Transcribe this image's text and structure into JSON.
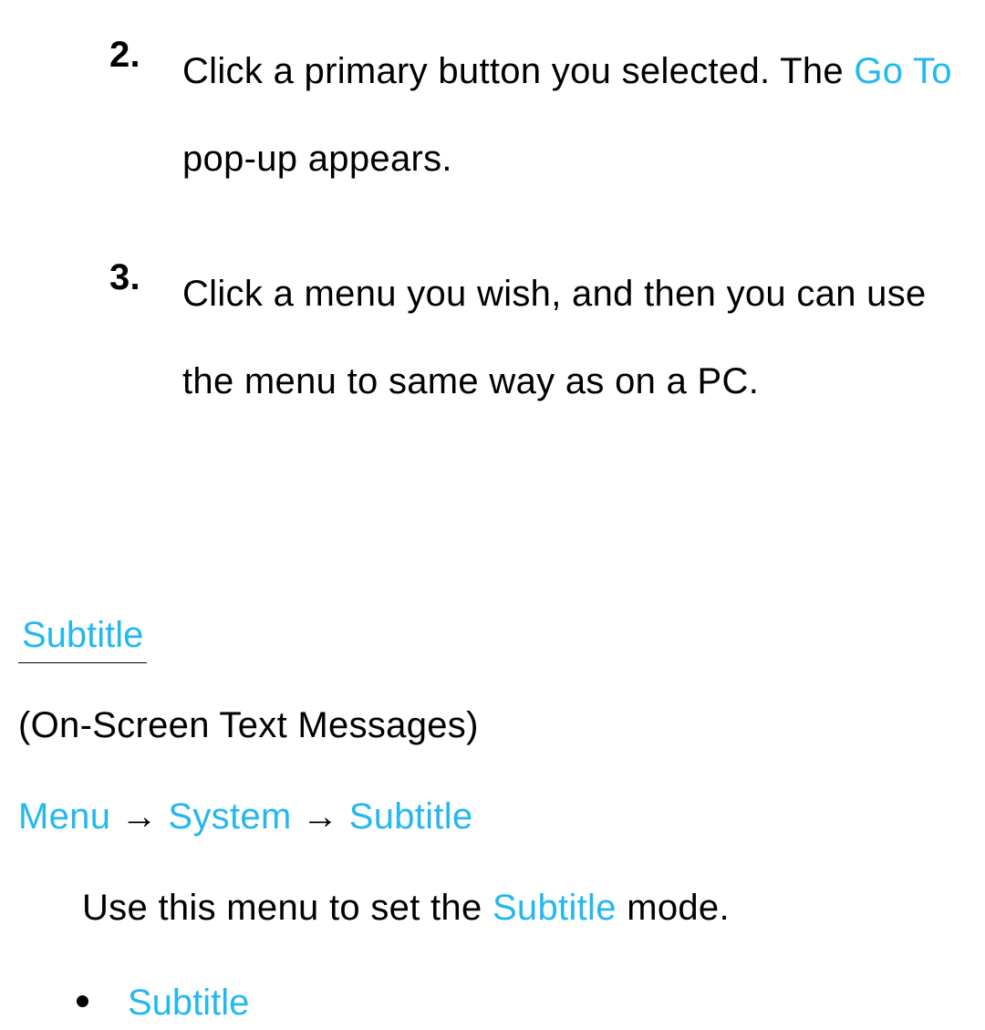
{
  "list": {
    "item2": {
      "number": "2.",
      "text_before": "Click a primary button you selected. The ",
      "highlight": "Go To",
      "text_after": " pop-up appears."
    },
    "item3": {
      "number": "3.",
      "text": "Click a menu you wish, and then you can use the menu to same way as on a PC."
    }
  },
  "section": {
    "heading": "Subtitle",
    "description": "(On-Screen Text Messages)"
  },
  "breadcrumb": {
    "part1": "Menu",
    "arrow": " → ",
    "part2": "System",
    "part3": "Subtitle"
  },
  "usage": {
    "before": "Use this menu to set the ",
    "highlight": "Subtitle",
    "after": " mode."
  },
  "bullet": {
    "item1": "Subtitle"
  }
}
